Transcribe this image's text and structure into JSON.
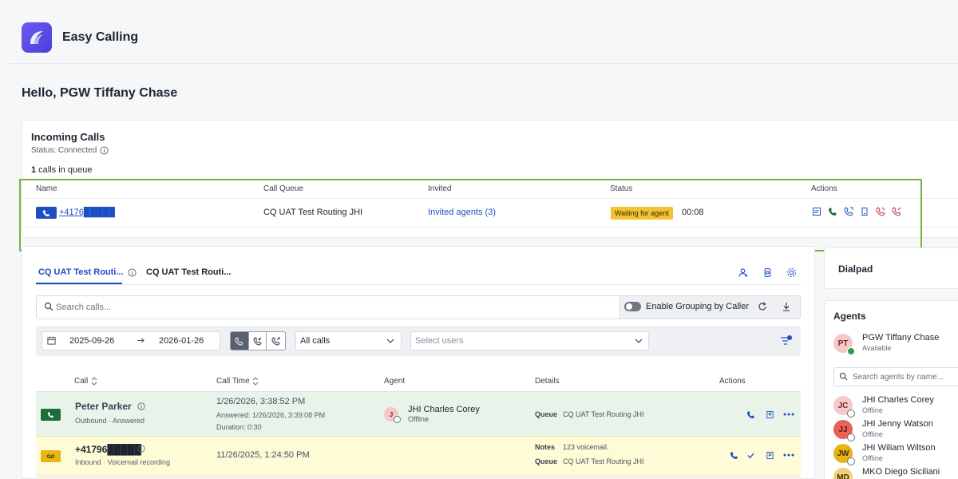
{
  "app": {
    "title": "Easy Calling"
  },
  "greeting": "Hello, PGW Tiffany Chase",
  "incoming": {
    "title": "Incoming Calls",
    "status": "Status: Connected",
    "queue_count": "1",
    "queue_suffix": " calls in queue",
    "columns": [
      "Name",
      "Call Queue",
      "Invited",
      "Status",
      "Actions"
    ],
    "call": {
      "number": "+4176█████",
      "queue": "CQ UAT Test Routing JHI",
      "invited": "Invited agents (3)",
      "status": "Waiting for agent",
      "timer": "00:08"
    }
  },
  "tabs": [
    "CQ UAT Test Routi...",
    "CQ UAT Test Routi..."
  ],
  "search": {
    "placeholder": "Search calls..."
  },
  "grouping": {
    "label": "Enable Grouping by Caller",
    "enabled": false
  },
  "filters": {
    "date_from": "2025-09-26",
    "date_to": "2026-01-26",
    "call_type": "All calls",
    "users_placeholder": "Select users"
  },
  "calls_table": {
    "columns": [
      "Call",
      "Call Time",
      "Agent",
      "Details",
      "Actions"
    ],
    "rows": [
      {
        "name": "Peter Parker",
        "direction": "Outbound · Answered",
        "time": "1/26/2026, 3:38:52 PM",
        "answered": "Answered: 1/26/2026, 3:39:08 PM",
        "duration": "Duration: 0:30",
        "agent_initials": "J",
        "agent_name": "JHI Charles Corey",
        "agent_status": "Offline",
        "queue_label": "Queue",
        "queue_value": "CQ UAT Test Routing JHI"
      },
      {
        "name": "+41796█████",
        "direction": "Inbound · Voicemail recording",
        "time": "11/26/2025, 1:24:50 PM",
        "notes_label": "Notes",
        "notes_value": "123 voicemail.",
        "queue_label": "Queue",
        "queue_value": "CQ UAT Test Routing JHI"
      }
    ]
  },
  "dialpad": {
    "label": "Dialpad"
  },
  "agents": {
    "title": "Agents",
    "me": {
      "initials": "PT",
      "name": "PGW Tiffany Chase",
      "status": "Available"
    },
    "search_placeholder": "Search agents by name...",
    "list": [
      {
        "initials": "JC",
        "name": "JHI Charles Corey",
        "status": "Offline",
        "color": "#f6c9c9"
      },
      {
        "initials": "JJ",
        "name": "JHI Jenny Watson",
        "status": "Offline",
        "color": "#e8625a"
      },
      {
        "initials": "JW",
        "name": "JHI Wiliam Wiltson",
        "status": "Offline",
        "color": "#e8b418"
      },
      {
        "initials": "MD",
        "name": "MKO Diego Siciliani",
        "status": "",
        "color": "#f0d27a"
      }
    ]
  },
  "colors": {
    "accent": "#1d4fc4",
    "waiting": "#f2c233",
    "highlight": "#7ab342",
    "answered_row": "#e9f3ea",
    "voicemail_row": "#fefcd6"
  }
}
